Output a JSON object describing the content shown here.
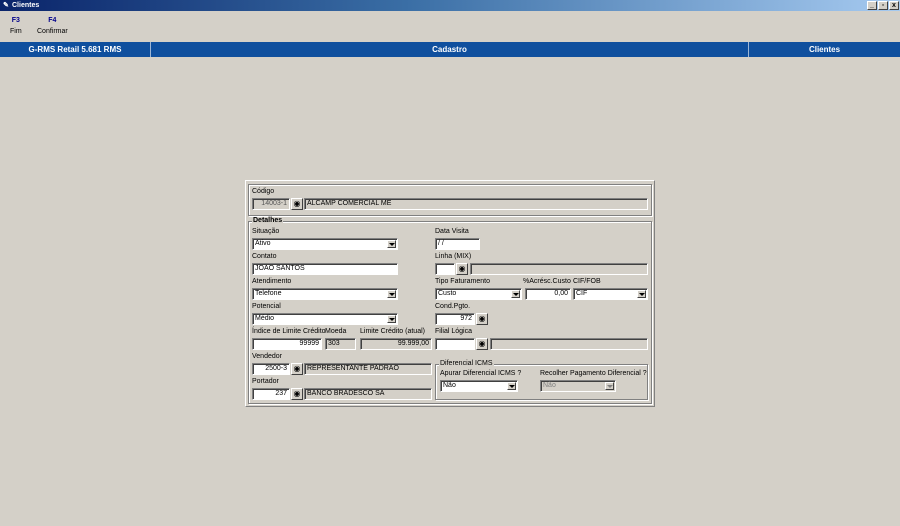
{
  "window": {
    "title": "Clientes",
    "buttons": [
      "_",
      "▫",
      "x"
    ]
  },
  "function_keys": [
    {
      "key": "F3",
      "label": "Fim"
    },
    {
      "key": "F4",
      "label": "Confirmar"
    }
  ],
  "header": {
    "left": "G-RMS Retail 5.681 RMS",
    "center": "Cadastro",
    "right": "Clientes"
  },
  "form": {
    "codigo_label": "Código",
    "codigo_value": "14003-1",
    "razao_social": "ALCAMP COMERCIAL ME",
    "detalhes_legend": "Detalhes",
    "situacao_label": "Situação",
    "situacao_value": "Ativo",
    "contato_label": "Contato",
    "contato_value": "JOAO SANTOS",
    "atendimento_label": "Atendimento",
    "atendimento_value": "Telefone",
    "potencial_label": "Potencial",
    "potencial_value": "Médio",
    "indice_label": "Índice de Limite Crédito",
    "indice_value": "99999",
    "moeda_label": "Moeda",
    "moeda_value": "303",
    "limite_label": "Limite Crédito (atual)",
    "limite_value": "99.999,00",
    "vendedor_label": "Vendedor",
    "vendedor_code": "2500-3",
    "vendedor_name": "REPRESENTANTE PADRAO",
    "portador_label": "Portador",
    "portador_code": "237",
    "portador_name": "BANCO BRADESCO SA",
    "data_visita_label": "Data Visita",
    "data_visita_value": " / /",
    "linha_label": "Linha (MIX)",
    "linha_value": "",
    "linha_desc": "",
    "tipo_fat_label": "Tipo Faturamento",
    "tipo_fat_value": "Custo",
    "acresc_label": "%Acrésc.Custo",
    "acresc_value": "0,00",
    "cif_label": "CIF/FOB",
    "cif_value": "CIF",
    "cond_label": "Cond.Pgto.",
    "cond_value": "972",
    "filial_label": "Filial Lógica",
    "filial_value": "",
    "filial_desc": "",
    "icms_legend": "Diferencial ICMS",
    "apurar_label": "Apurar Diferencial ICMS ?",
    "apurar_value": "Não",
    "recolher_label": "Recolher Pagamento Diferencial ?",
    "recolher_value": "Não"
  },
  "icons": {
    "search": "binoculars-icon",
    "dropdown": "chevron-down-icon",
    "app": "app-icon"
  }
}
